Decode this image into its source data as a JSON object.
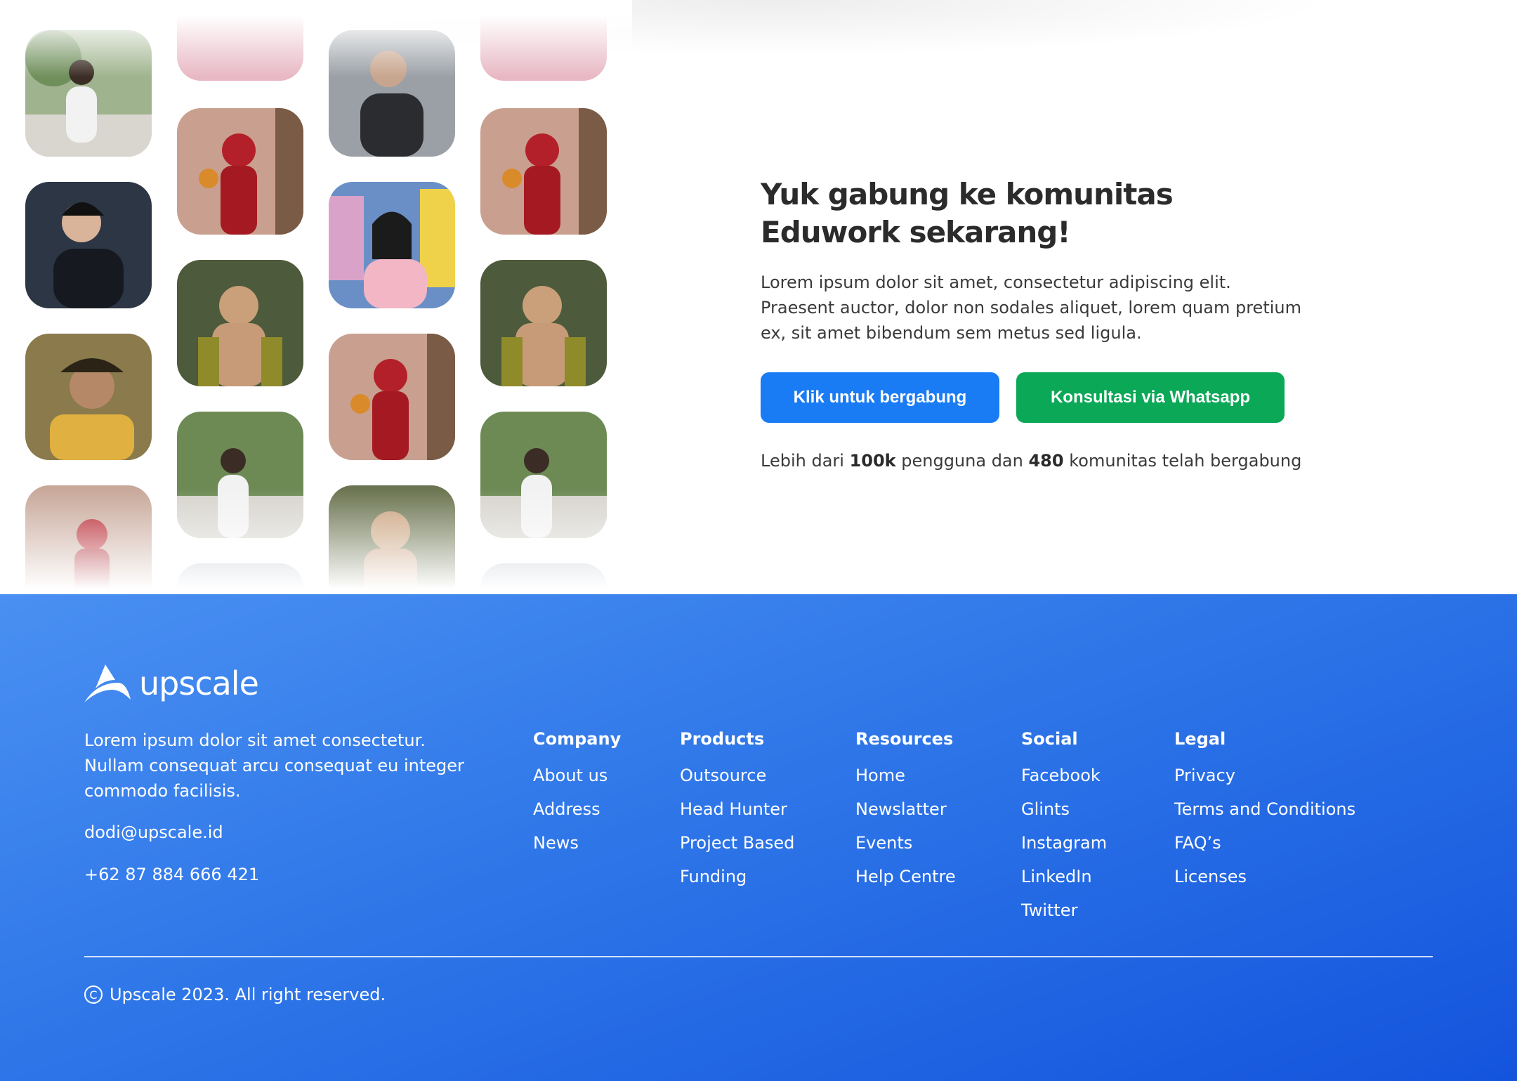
{
  "cta": {
    "title": "Yuk gabung ke komunitas Eduwork sekarang!",
    "description": "Lorem ipsum dolor sit amet, consectetur adipiscing elit. Praesent auctor, dolor non sodales aliquet, lorem quam pretium ex, sit amet bibendum sem metus sed ligula.",
    "join_button": "Klik untuk bergabung",
    "whatsapp_button": "Konsultasi via Whatsapp",
    "stats_prefix": "Lebih dari ",
    "stats_users": "100k",
    "stats_middle": " pengguna dan ",
    "stats_communities": "480",
    "stats_suffix": " komunitas telah bergabung"
  },
  "colors": {
    "primary": "#1a7cf5",
    "whatsapp": "#0aa857",
    "footer_start": "#4a90f2",
    "footer_end": "#1454dd"
  },
  "footer": {
    "brand": "upscale",
    "description": "Lorem ipsum dolor sit amet consectetur. Nullam consequat arcu consequat eu integer commodo facilisis.",
    "email": "dodi@upscale.id",
    "phone": "+62 87 884 666 421",
    "columns": [
      {
        "title": "Company",
        "links": [
          "About us",
          "Address",
          "News"
        ]
      },
      {
        "title": "Products",
        "links": [
          "Outsource",
          "Head Hunter",
          "Project Based",
          "Funding"
        ]
      },
      {
        "title": "Resources",
        "links": [
          "Home",
          "Newslatter",
          "Events",
          "Help Centre"
        ]
      },
      {
        "title": "Social",
        "links": [
          "Facebook",
          "Glints",
          "Instagram",
          "LinkedIn",
          "Twitter"
        ]
      },
      {
        "title": "Legal",
        "links": [
          "Privacy",
          "Terms and Conditions",
          "FAQ’s",
          "Licenses"
        ]
      }
    ],
    "copyright_symbol": "C",
    "copyright": "Upscale 2023. All right reserved."
  }
}
